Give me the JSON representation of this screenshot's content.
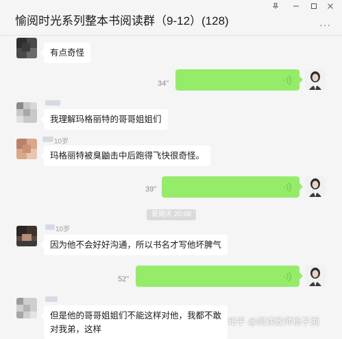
{
  "window": {
    "title": "愉阅时光系列整本书阅读群（9-12）(128)",
    "controls": [
      "pin-icon",
      "minimize-icon",
      "maximize-icon",
      "close-icon"
    ],
    "more_label": "···"
  },
  "messages": [
    {
      "type": "text",
      "side": "left",
      "text": "有点奇怪"
    },
    {
      "type": "voice",
      "side": "right",
      "duration": "34\""
    },
    {
      "type": "text",
      "side": "left",
      "text": "我理解玛格丽特的哥哥姐姐们"
    },
    {
      "type": "text",
      "side": "left",
      "sender": "10岁",
      "text": "玛格丽特被臭鼬击中后跑得飞快很奇怪。"
    },
    {
      "type": "voice",
      "side": "right",
      "duration": "39\""
    },
    {
      "type": "time",
      "text": "星期天 20:08"
    },
    {
      "type": "text",
      "side": "left",
      "sender": "10岁",
      "text": "因为他不会好好沟通，所以书名才写他坏脾气"
    },
    {
      "type": "voice",
      "side": "right",
      "duration": "52\""
    },
    {
      "type": "text",
      "side": "left",
      "text_line1": "但是他的哥哥姐姐们不能这样对他，我都不敢",
      "text_line2": "对我弟，这样"
    }
  ],
  "watermark": "知乎 @阅读教师杨子湘",
  "colors": {
    "chat_bg": "#f5f5f5",
    "bubble_in": "#ffffff",
    "bubble_out": "#95ec69",
    "voice_wave": "#7bcb55"
  }
}
